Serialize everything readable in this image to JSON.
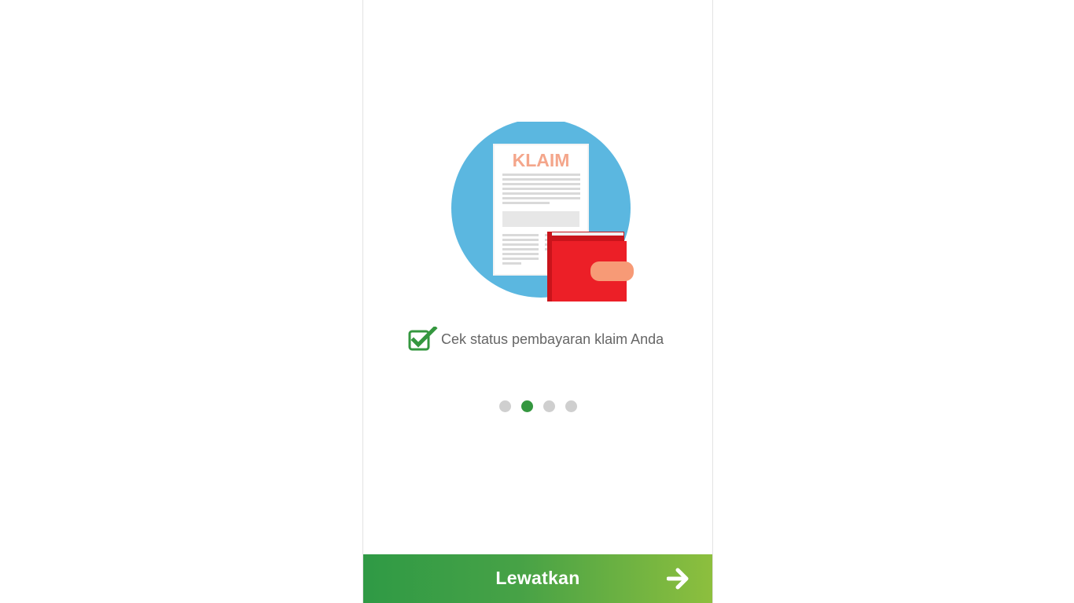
{
  "onboarding": {
    "illustration": {
      "icon": "claim-document-wallet-icon",
      "doc_title": "KLAIM"
    },
    "feature": {
      "icon": "checkbox-checked-icon",
      "text": "Cek status pembayaran klaim Anda"
    },
    "pagination": {
      "total": 4,
      "active_index": 1
    },
    "skip_button": {
      "label": "Lewatkan",
      "icon": "arrow-right-icon"
    }
  },
  "colors": {
    "primary_green": "#34973f",
    "gradient_end": "#8dbf3e",
    "circle_blue": "#5bb7e0",
    "wallet_red": "#ec1f27",
    "klaim_text": "#f4a68b"
  }
}
